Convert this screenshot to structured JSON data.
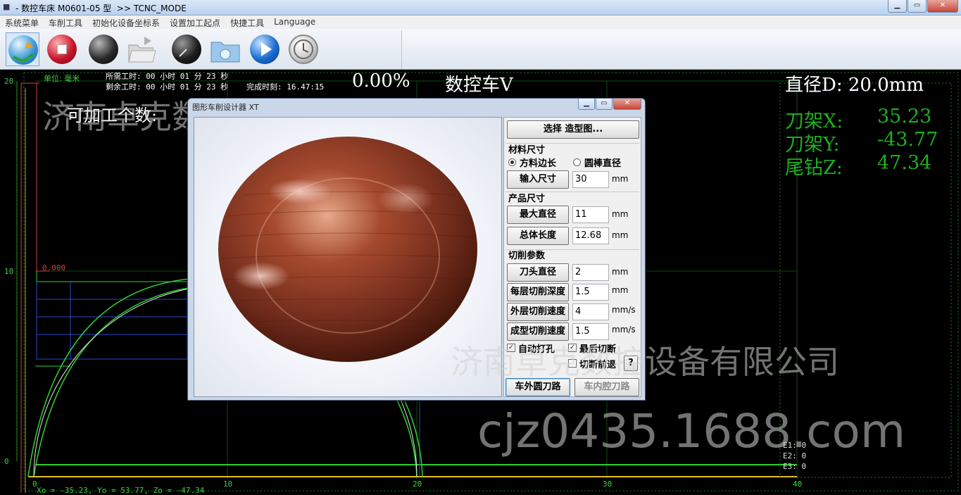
{
  "window": {
    "title": "- 数控车床 M0601-05 型  >> TCNC_MODE",
    "min_glyph": "▁",
    "max_glyph": "▭",
    "close_glyph": "✕"
  },
  "menu": [
    "系统菜单",
    "车削工具",
    "初始化设备坐标系",
    "设置加工起点",
    "快捷工具",
    "Language"
  ],
  "toolbar_icons": [
    "refresh-icon",
    "stop-icon",
    "black-sphere-icon",
    "open-folder-icon",
    "radar-icon",
    "camera-folder-icon",
    "play-icon",
    "history-clock-icon"
  ],
  "status": {
    "unit": "单位: 毫米",
    "required_time": "所需工时: 00 小时 01 分 23 秒",
    "remaining_time": "剩余工时: 00 小时 01 分 23 秒",
    "finish_time": "完成时刻: 16.47:15",
    "progress": "0.00%",
    "mode": "数控车V",
    "diameter": "直径D: 20.0mm",
    "tool_x_label": "刀架X:",
    "tool_x_value": "35.23",
    "tool_y_label": "刀架Y:",
    "tool_y_value": "-43.77",
    "tail_z_label": "尾钻Z:",
    "tail_z_value": "47.34",
    "machinable": "可加工个数:",
    "bottom_coords": "Xo = -35.23, Yo = 53.77, Zo = -47.34",
    "e1": "E1: 0",
    "e2": "E2: 0",
    "e3": "E3: 0",
    "marker": "0.000"
  },
  "axes": {
    "y_ticks": [
      "20",
      "10",
      "0"
    ],
    "x_ticks": [
      "0",
      "10",
      "20",
      "30",
      "40"
    ]
  },
  "watermarks": {
    "company": "济南卓克数控设备有限公司",
    "url": "cjz0435.1688.com"
  },
  "dialog": {
    "title": "图形车削设计器 XT",
    "select_model": "选择 造型图...",
    "material_size": "材料尺寸",
    "radio_square": "方料边长",
    "radio_round": "圆棒直径",
    "input_size_btn": "输入尺寸",
    "input_size_value": "30",
    "product_size": "产品尺寸",
    "max_diameter_btn": "最大直径",
    "max_diameter_value": "11",
    "total_length_btn": "总体长度",
    "total_length_value": "12.68",
    "cut_params": "切削参数",
    "tool_diameter_btn": "刀头直径",
    "tool_diameter_value": "2",
    "layer_depth_btn": "每层切削深度",
    "layer_depth_value": "1.5",
    "outer_speed_btn": "外层切削速度",
    "outer_speed_value": "4",
    "form_speed_btn": "成型切削速度",
    "form_speed_value": "1.5",
    "unit_mm": "mm",
    "unit_mms": "mm/s",
    "auto_tap": "自动打孔",
    "last_cut": "最后切断",
    "cut_before_retract": "切断前退",
    "help": "?",
    "outer_path_btn": "车外圆刀路",
    "inner_path_btn": "车内腔刀路",
    "check_mark": "✓"
  }
}
